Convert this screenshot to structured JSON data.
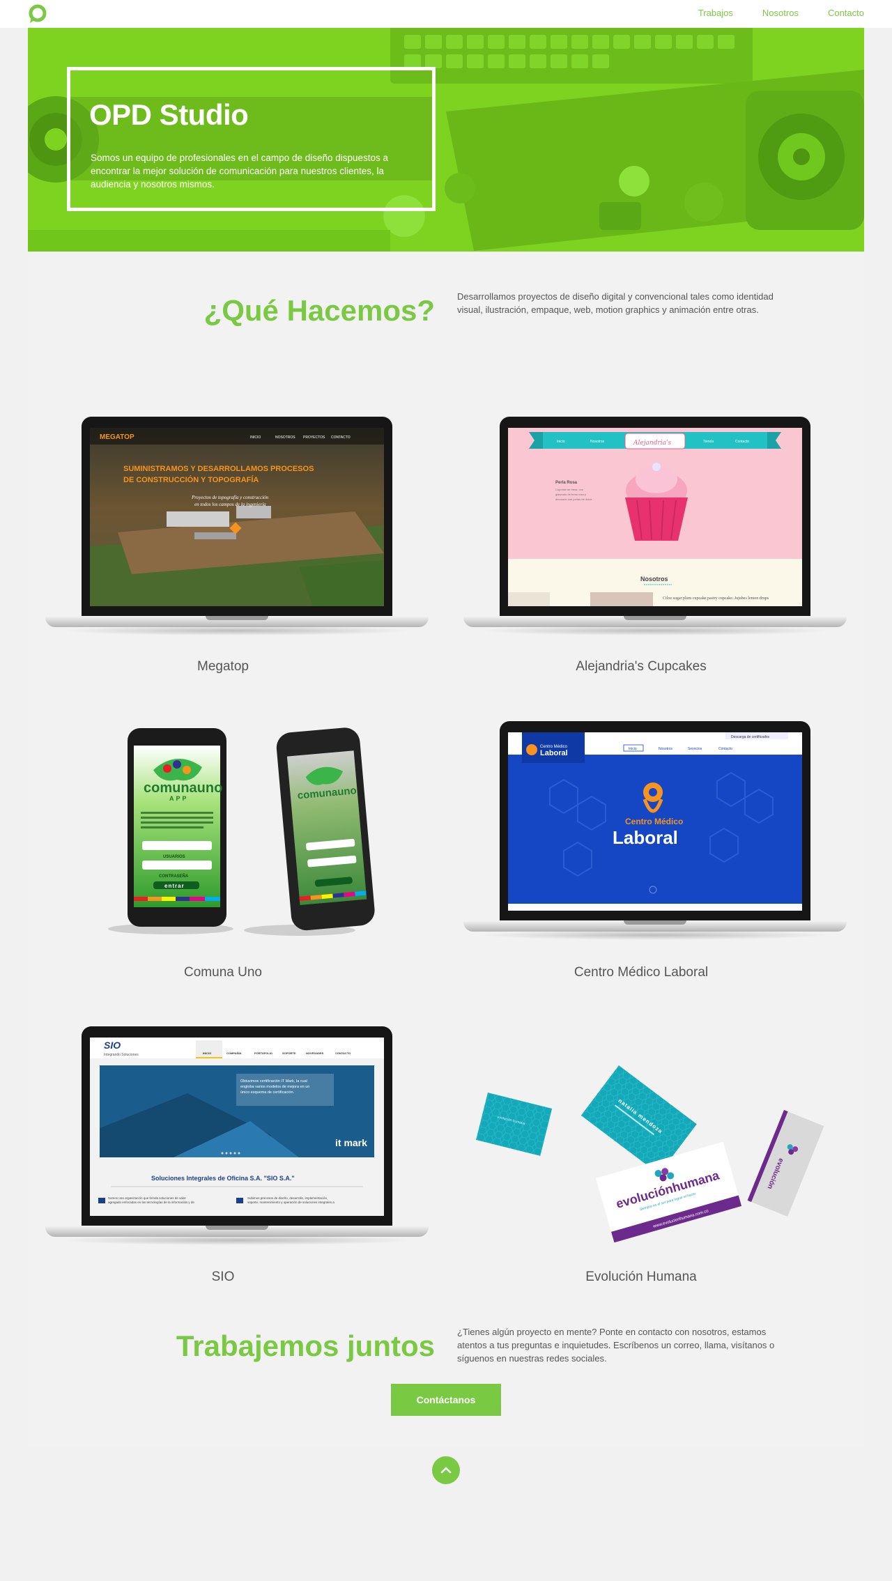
{
  "nav": {
    "links": [
      "Trabajos",
      "Nosotros",
      "Contacto"
    ]
  },
  "hero": {
    "title": "OPD Studio",
    "text": "Somos un equipo de profesionales en el campo de diseño dispuestos a encontrar la mejor solución de comunicación para nuestros clientes, la audiencia y nosotros mismos."
  },
  "what": {
    "title": "¿Qué Hacemos?",
    "text": "Desarrollamos proyectos de diseño digital y convencional tales como identidad visual, ilustración, empaque, web, motion graphics y animación entre otras."
  },
  "portfolio": {
    "items": [
      {
        "name": "Megatop"
      },
      {
        "name": "Alejandria's Cupcakes"
      },
      {
        "name": "Comuna Uno"
      },
      {
        "name": "Centro Médico Laboral"
      },
      {
        "name": "SIO"
      },
      {
        "name": "Evolución Humana"
      }
    ]
  },
  "screens": {
    "megatop": {
      "logo": "MEGATOP",
      "menu": [
        "INICIO",
        "NOSOTROS",
        "PROYECTOS",
        "CONTACTO"
      ],
      "headline1": "SUMINISTRAMOS Y DESARROLLAMOS PROCESOS",
      "headline2": "DE CONSTRUCCIÓN Y TOPOGRAFÍA",
      "sub1": "Proyectos de topografía y construcción",
      "sub2": "en todos los campos de la ingeniería"
    },
    "cupcakes": {
      "menu": [
        "Inicio",
        "Nosotros",
        "Alejandria's",
        "Tienda",
        "Contacto"
      ],
      "product": "Perla Rosa",
      "product_text": "Cupcake de fresa, con glaseado de fresa rosa y decorado con perlas de dulce.",
      "section": "Nosotros",
      "lorem": "Ciloe sugar plum cupcake pastry cupcake. Jujubes lemon drops"
    },
    "comuna": {
      "logo": "comunauno",
      "sub": "APP",
      "intro": "Esta es la aplicación de la comuna uno. En ella podrás encontrar gran cantidad de eventos, noticias e información muy interesante para ti y de gran beneficio para tu comunidad. Que esperas...",
      "user_label": "USUARIOS",
      "pass_label": "CONTRASEÑA",
      "button": "entrar"
    },
    "medico": {
      "logo_small": "Centro Médico",
      "logo_big": "Laboral",
      "download": "Descarga de certificados",
      "menu": [
        "Inicio",
        "Nosotros",
        "Servicios",
        "Contacto"
      ],
      "center1": "Centro Médico",
      "center2": "Laboral"
    },
    "sio": {
      "logo": "SIO",
      "tagline": "Integrando Soluciones",
      "menu": [
        "INICIO",
        "COMPAÑÍA",
        "PORTAFOLIO",
        "SOPORTE",
        "NOVEDADES",
        "CONTACTO"
      ],
      "banner": "Obtuvimos certificación IT Mark, la cual engloba varios modelos de mejora en un único esquema de certificación.",
      "mark": "it mark",
      "heading": "Soluciones Integrales de Oficina S.A. \"SIO S.A.\"",
      "col1": "Somos una organización que brinda soluciones de valor agregado enfocadas en las tecnologías de la información y de",
      "col2": "Subimos procesos de diseño, desarrollo, implementación, soporte, mantenimiento y operación de soluciones integrales a"
    },
    "evolucion": {
      "brand": "evoluciónhumana",
      "slogan": "Siempre es el ser para lograr el hacer",
      "site": "www.evolucionhumana.com.co",
      "card_name": "natalia mendoza"
    }
  },
  "cta": {
    "title": "Trabajemos juntos",
    "text": "¿Tienes algún proyecto en mente? Ponte en contacto con nosotros, estamos atentos a tus preguntas e inquietudes. Escríbenos un correo, llama, visítanos o síguenos en nuestras redes sociales.",
    "button": "Contáctanos"
  },
  "colors": {
    "accent": "#7ac943",
    "hero": "#7ed321"
  },
  "icons": {
    "logo": "o-logo-icon",
    "scroll_top": "chevron-up-icon"
  }
}
